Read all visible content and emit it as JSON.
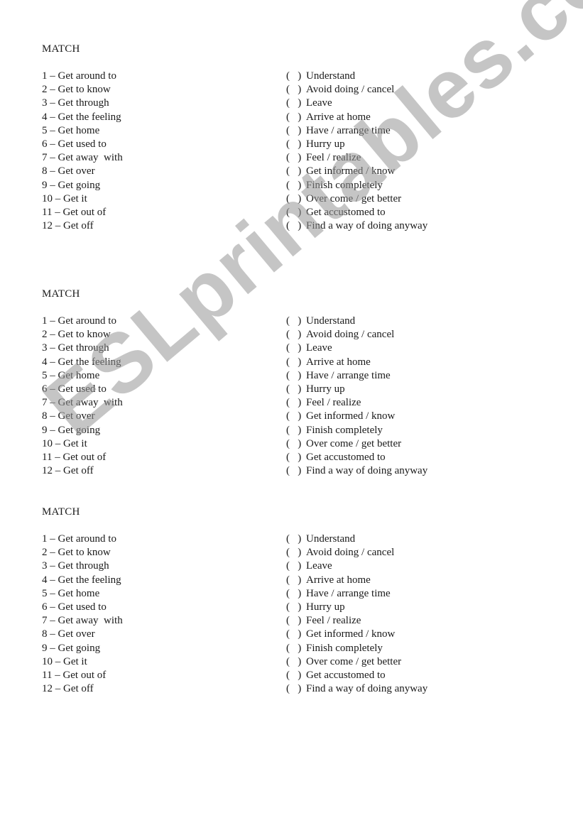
{
  "watermark": "ESLprintables.com",
  "blocks": [
    {
      "title": "MATCH",
      "left_items": [
        "1 – Get around to",
        "2 – Get to know",
        "3 – Get through",
        "4 – Get the feeling",
        "5 – Get home",
        "6 – Get used to",
        "7 – Get away  with",
        "8 – Get over",
        "9 – Get going",
        "10 – Get it",
        "11 – Get out of",
        "12 – Get off"
      ],
      "right_items": [
        "Understand",
        "Avoid doing / cancel",
        "Leave",
        "Arrive at home",
        "Have / arrange time",
        "Hurry up",
        "Feel / realize",
        "Get informed / know",
        "Finish completely",
        "Over come / get better",
        "Get accustomed to",
        "Find a way of doing anyway"
      ]
    },
    {
      "title": "MATCH",
      "left_items": [
        "1 – Get around to",
        "2 – Get to know",
        "3 – Get through",
        "4 – Get the feeling",
        "5 – Get home",
        "6 – Get used to",
        "7 – Get away  with",
        "8 – Get over",
        "9 – Get going",
        "10 – Get it",
        "11 – Get out of",
        "12 – Get off"
      ],
      "right_items": [
        "Understand",
        "Avoid doing / cancel",
        "Leave",
        "Arrive at home",
        "Have / arrange time",
        "Hurry up",
        "Feel / realize",
        "Get informed / know",
        "Finish completely",
        "Over come / get better",
        "Get accustomed to",
        "Find a way of doing anyway"
      ]
    },
    {
      "title": "MATCH",
      "left_items": [
        "1 – Get around to",
        "2 – Get to know",
        "3 – Get through",
        "4 – Get the feeling",
        "5 – Get home",
        "6 – Get used to",
        "7 – Get away  with",
        "8 – Get over",
        "9 – Get going",
        "10 – Get it",
        "11 – Get out of",
        "12 – Get off"
      ],
      "right_items": [
        "Understand",
        "Avoid doing / cancel",
        "Leave",
        "Arrive at home",
        "Have / arrange time",
        "Hurry up",
        "Feel / realize",
        "Get informed / know",
        "Finish completely",
        "Over come / get better",
        "Get accustomed to",
        "Find a way of doing anyway"
      ]
    }
  ],
  "answer_blank": "(   )"
}
